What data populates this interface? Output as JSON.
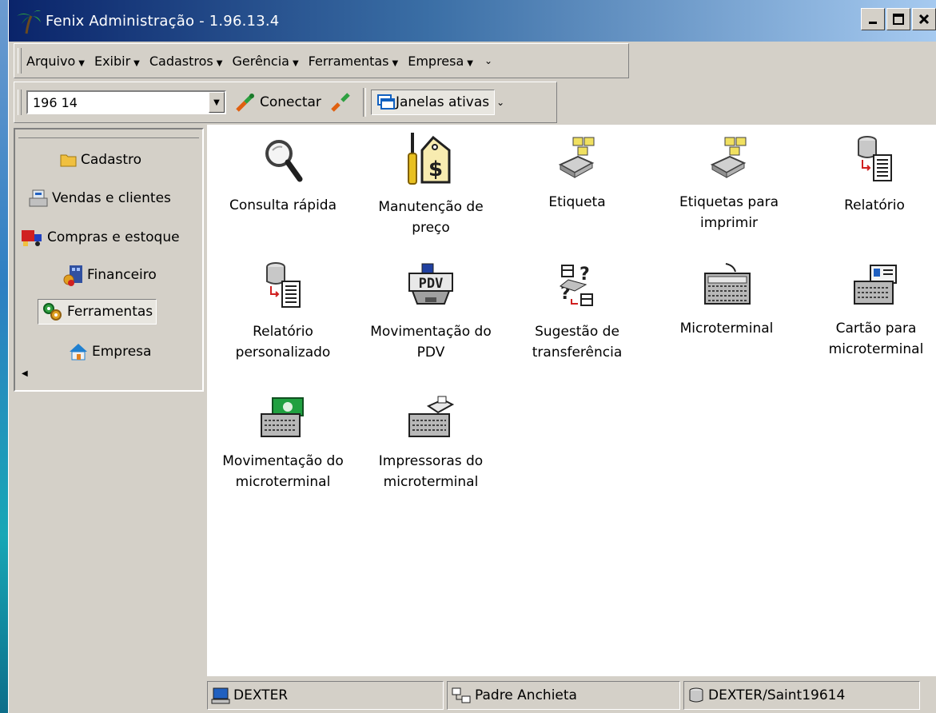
{
  "window": {
    "title": "Fenix Administração - 1.96.13.4"
  },
  "menu": {
    "items": [
      "Arquivo",
      "Exibir",
      "Cadastros",
      "Gerência",
      "Ferramentas",
      "Empresa"
    ]
  },
  "toolbar": {
    "combo_value": "196 14",
    "connect_label": "Conectar",
    "active_windows_label": "Janelas ativas"
  },
  "sidebar": {
    "items": [
      {
        "label": "Cadastro",
        "icon": "folder-icon"
      },
      {
        "label": "Vendas e clientes",
        "icon": "cash-register-icon"
      },
      {
        "label": "Compras e estoque",
        "icon": "truck-icon"
      },
      {
        "label": "Financeiro",
        "icon": "building-money-icon"
      },
      {
        "label": "Ferramentas",
        "icon": "gears-icon",
        "active": true
      },
      {
        "label": "Empresa",
        "icon": "house-icon"
      }
    ]
  },
  "tiles": [
    {
      "line1": "Consulta rápida",
      "line2": "",
      "icon": "magnifier-icon"
    },
    {
      "line1": "Manutenção de",
      "line2": "preço",
      "icon": "price-tag-icon"
    },
    {
      "line1": "Etiqueta",
      "line2": "",
      "icon": "label-printer-icon"
    },
    {
      "line1": "Etiquetas para",
      "line2": "imprimir",
      "icon": "label-printer-icon"
    },
    {
      "line1": "Relatório",
      "line2": "",
      "icon": "report-icon"
    },
    {
      "line1": "Relatório",
      "line2": "personalizado",
      "icon": "report-icon"
    },
    {
      "line1": "Movimentação do",
      "line2": "PDV",
      "icon": "pdv-icon"
    },
    {
      "line1": "Sugestão de",
      "line2": "transferência",
      "icon": "transfer-suggestion-icon"
    },
    {
      "line1": "Microterminal",
      "line2": "",
      "icon": "keyboard-icon"
    },
    {
      "line1": "Cartão para",
      "line2": "microterminal",
      "icon": "keyboard-card-icon"
    },
    {
      "line1": "Movimentação do",
      "line2": "microterminal",
      "icon": "keyboard-money-icon"
    },
    {
      "line1": "Impressoras do",
      "line2": "microterminal",
      "icon": "keyboard-printer-icon"
    }
  ],
  "pdv_label": "PDV",
  "statusbar": {
    "computer": "DEXTER",
    "branch": "Padre Anchieta",
    "database": "DEXTER/Saint19614"
  }
}
